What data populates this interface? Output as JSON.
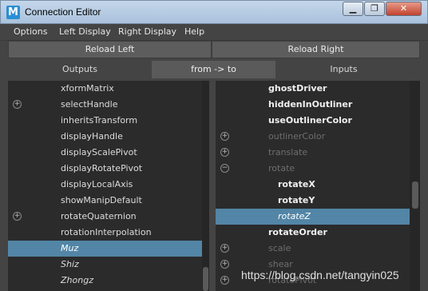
{
  "window": {
    "title": "Connection Editor",
    "app_icon_letter": "M",
    "buttons": [
      "▁",
      "❐",
      "✕"
    ]
  },
  "menu": [
    "Options",
    "Left Display",
    "Right Display",
    "Help"
  ],
  "reload": {
    "left": "Reload Left",
    "right": "Reload Right"
  },
  "tabs": {
    "outputs": "Outputs",
    "from_to": "from -> to",
    "inputs": "Inputs"
  },
  "left_list": [
    {
      "label": "xformMatrix",
      "expand": false,
      "style": "normal"
    },
    {
      "label": "selectHandle",
      "expand": true,
      "style": "normal"
    },
    {
      "label": "inheritsTransform",
      "expand": false,
      "style": "normal"
    },
    {
      "label": "displayHandle",
      "expand": false,
      "style": "normal"
    },
    {
      "label": "displayScalePivot",
      "expand": false,
      "style": "normal"
    },
    {
      "label": "displayRotatePivot",
      "expand": false,
      "style": "normal"
    },
    {
      "label": "displayLocalAxis",
      "expand": false,
      "style": "normal"
    },
    {
      "label": "showManipDefault",
      "expand": false,
      "style": "normal"
    },
    {
      "label": "rotateQuaternion",
      "expand": true,
      "style": "normal"
    },
    {
      "label": "rotationInterpolation",
      "expand": false,
      "style": "normal"
    },
    {
      "label": "Muz",
      "expand": false,
      "style": "selected-italic"
    },
    {
      "label": "Shiz",
      "expand": false,
      "style": "italic"
    },
    {
      "label": "Zhongz",
      "expand": false,
      "style": "italic"
    }
  ],
  "right_list": [
    {
      "label": "ghostDriver",
      "expand": false,
      "style": "bold",
      "indent": 0
    },
    {
      "label": "hiddenInOutliner",
      "expand": false,
      "style": "bold",
      "indent": 0
    },
    {
      "label": "useOutlinerColor",
      "expand": false,
      "style": "bold",
      "indent": 0
    },
    {
      "label": "outlinerColor",
      "expand": "plus",
      "style": "dim",
      "indent": 0
    },
    {
      "label": "translate",
      "expand": "plus",
      "style": "dim",
      "indent": 0
    },
    {
      "label": "rotate",
      "expand": "minus",
      "style": "dim",
      "indent": 0
    },
    {
      "label": "rotateX",
      "expand": false,
      "style": "bold",
      "indent": 1
    },
    {
      "label": "rotateY",
      "expand": false,
      "style": "bold",
      "indent": 1
    },
    {
      "label": "rotateZ",
      "expand": false,
      "style": "selected-italic",
      "indent": 1
    },
    {
      "label": "rotateOrder",
      "expand": false,
      "style": "bold",
      "indent": 0
    },
    {
      "label": "scale",
      "expand": "plus",
      "style": "dim",
      "indent": 0
    },
    {
      "label": "shear",
      "expand": "plus",
      "style": "dim",
      "indent": 0
    },
    {
      "label": "rotatePivot",
      "expand": "plus",
      "style": "dim",
      "indent": 0
    }
  ],
  "watermark": "https://blog.csdn.net/tangyin025",
  "colors": {
    "selection": "#5285a6",
    "panel_bg": "#2b2b2b",
    "window_bg": "#444444"
  }
}
